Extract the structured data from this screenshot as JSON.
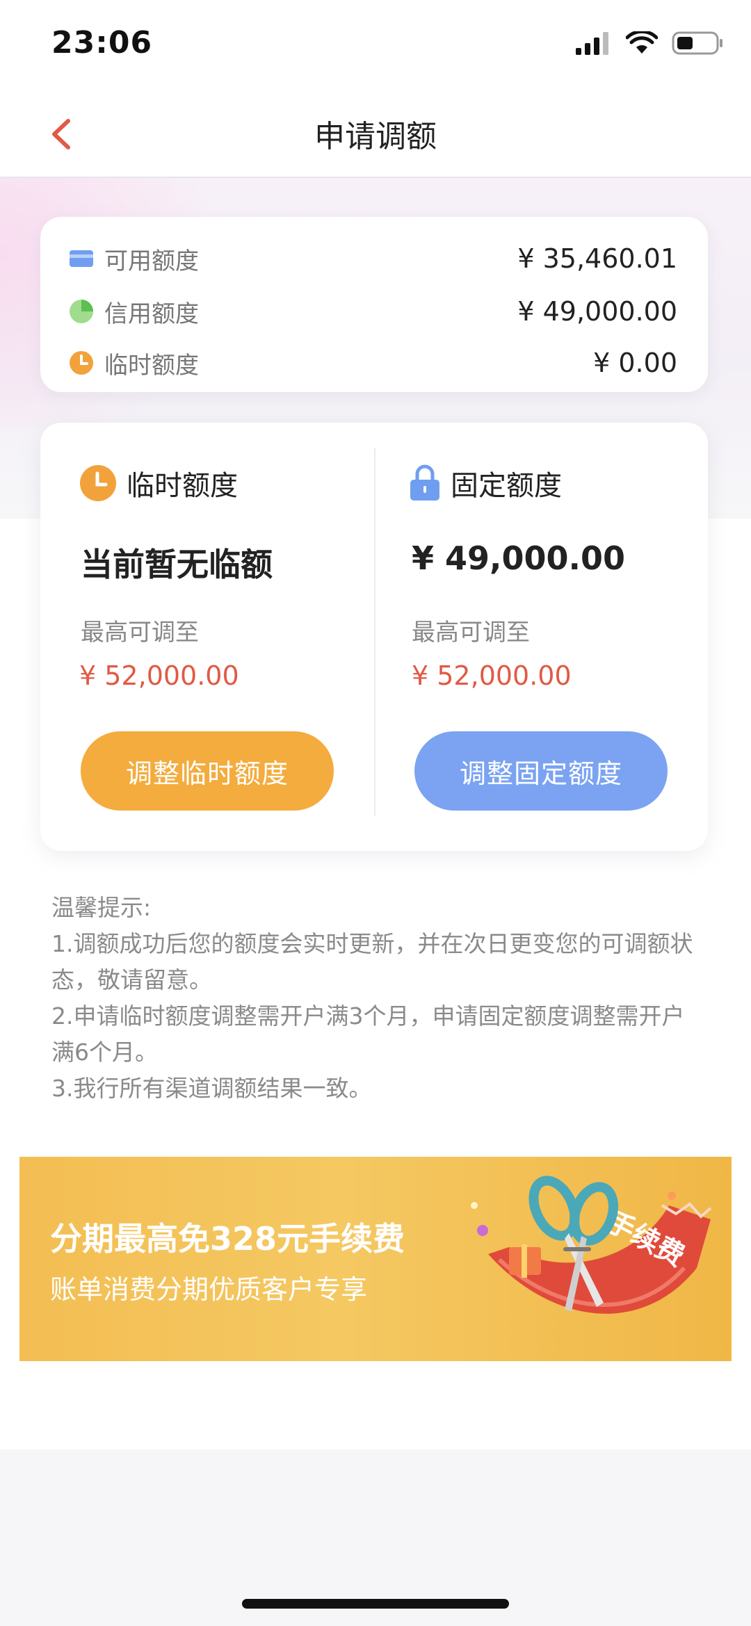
{
  "status": {
    "time": "23:06"
  },
  "nav": {
    "title": "申请调额"
  },
  "summary": [
    {
      "label": "可用额度",
      "value": "¥ 35,460.01",
      "icon": "card-icon"
    },
    {
      "label": "信用额度",
      "value": "¥ 49,000.00",
      "icon": "pie-icon"
    },
    {
      "label": "临时额度",
      "value": "¥ 0.00",
      "icon": "clock-icon"
    }
  ],
  "temp": {
    "title": "临时额度",
    "current": "当前暂无临额",
    "max_label": "最高可调至",
    "max_value": "¥ 52,000.00",
    "button": "调整临时额度"
  },
  "fixed": {
    "title": "固定额度",
    "current": "¥ 49,000.00",
    "max_label": "最高可调至",
    "max_value": "¥ 52,000.00",
    "button": "调整固定额度"
  },
  "tips": {
    "title": "温馨提示:",
    "items": [
      "1.调额成功后您的额度会实时更新，并在次日更变您的可调额状态，敬请留意。",
      "2.申请临时额度调整需开户满3个月，申请固定额度调整需开户满6个月。",
      "3.我行所有渠道调额结果一致。"
    ]
  },
  "banner": {
    "title": "分期最高免328元手续费",
    "subtitle": "账单消费分期优质客户专享",
    "art_label": "手续费"
  },
  "colors": {
    "accent_orange": "#f3ac3d",
    "accent_blue": "#7ba3f1",
    "value_red": "#e05a45",
    "back_arrow": "#e05a45"
  }
}
